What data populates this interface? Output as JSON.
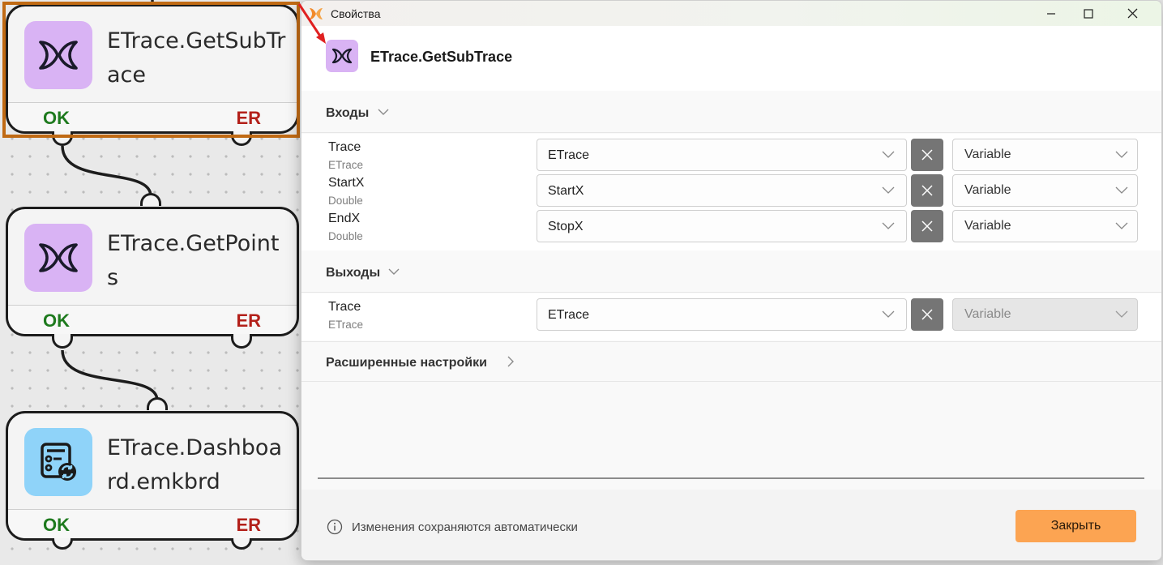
{
  "canvas": {
    "nodes": [
      {
        "title": "ETrace.GetSubTrace",
        "icon": "butterfly-icon",
        "ok": "OK",
        "er": "ER",
        "selected": true
      },
      {
        "title": "ETrace.GetPoints",
        "icon": "butterfly-icon",
        "ok": "OK",
        "er": "ER",
        "selected": false
      },
      {
        "title": "ETrace.Dashboard.emkbrd",
        "icon": "dashboard-sync-icon",
        "ok": "OK",
        "er": "ER",
        "selected": false
      }
    ]
  },
  "dialog": {
    "window_title": "Свойства",
    "header_title": "ETrace.GetSubTrace",
    "inputs": {
      "label": "Входы",
      "params": [
        {
          "name": "Trace",
          "type": "ETrace",
          "value": "ETrace",
          "kind": "Variable"
        },
        {
          "name": "StartX",
          "type": "Double",
          "value": "StartX",
          "kind": "Variable"
        },
        {
          "name": "EndX",
          "type": "Double",
          "value": "StopX",
          "kind": "Variable"
        }
      ]
    },
    "outputs": {
      "label": "Выходы",
      "params": [
        {
          "name": "Trace",
          "type": "ETrace",
          "value": "ETrace",
          "kind": "Variable",
          "kind_disabled": true
        }
      ]
    },
    "advanced_label": "Расширенные настройки",
    "footer_info": "Изменения сохраняются автоматически",
    "close_label": "Закрыть"
  },
  "colors": {
    "selection": "#c06a14",
    "ok": "#1e7a1e",
    "er": "#b3201a",
    "butterfly_bg": "#d9b3f4",
    "dashboard_bg": "#8fd3f9",
    "close_button": "#fca452"
  }
}
